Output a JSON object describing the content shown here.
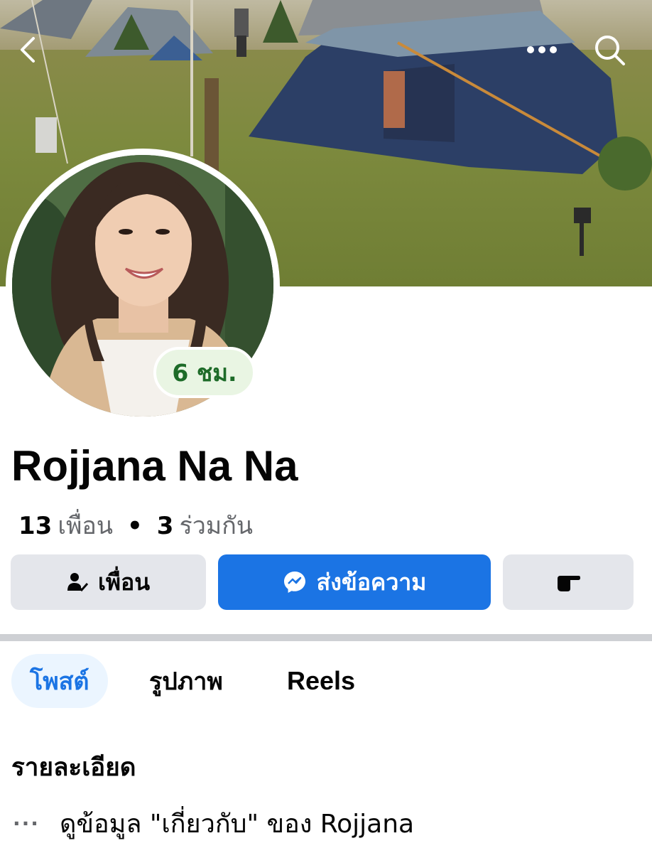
{
  "header": {
    "back_icon": "chevron-left-icon",
    "more_icon": "more-dots-icon",
    "search_icon": "search-icon"
  },
  "profile": {
    "name": "Rojjana Na Na",
    "active_badge": "6 ชม.",
    "friends_count": "13",
    "friends_label": "เพื่อน",
    "mutual_count": "3",
    "mutual_label": "ร่วมกัน"
  },
  "actions": {
    "friend_label": "เพื่อน",
    "message_label": "ส่งข้อความ",
    "more_icon": "pointing-hand-icon"
  },
  "tabs": [
    {
      "label": "โพสต์",
      "active": true
    },
    {
      "label": "รูปภาพ",
      "active": false
    },
    {
      "label": "Reels",
      "active": false
    }
  ],
  "details": {
    "title": "รายละเอียด",
    "about_text": "ดูข้อมูล \"เกี่ยวกับ\" ของ Rojjana"
  },
  "colors": {
    "accent": "#1b74e4",
    "badge_bg": "#e9f5e3",
    "badge_text": "#1d6b28",
    "button_gray": "#e4e6eb"
  }
}
